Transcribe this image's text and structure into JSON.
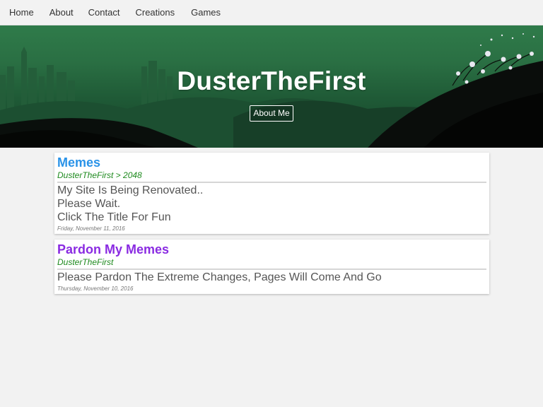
{
  "nav": {
    "items": [
      "Home",
      "About",
      "Contact",
      "Creations",
      "Games"
    ]
  },
  "hero": {
    "title": "DusterTheFirst",
    "button_label": "About Me"
  },
  "posts": [
    {
      "title": "Memes",
      "meta": "DusterTheFirst > 2048",
      "lines": [
        "My Site Is Being Renovated..",
        "Please Wait.",
        "Click The Title For Fun"
      ],
      "date": "Friday, November 11, 2016",
      "title_color": "#2a93e8"
    },
    {
      "title": "Pardon My Memes",
      "meta": "DusterTheFirst",
      "lines": [
        "Please Pardon The Extreme Changes, Pages Will Come And Go"
      ],
      "date": "Thursday, November 10, 2016",
      "title_color": "#8a2be2"
    }
  ],
  "colors": {
    "background": "#f2f2f2",
    "hero_green": "#2a6f43",
    "meta_green": "#1e8a1e"
  }
}
